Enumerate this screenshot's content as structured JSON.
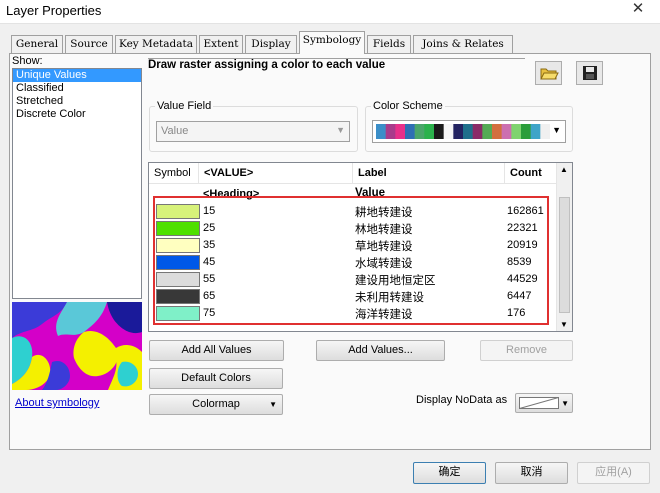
{
  "window": {
    "title": "Layer Properties",
    "close_glyph": "✕"
  },
  "tabs": [
    {
      "label": "General"
    },
    {
      "label": "Source"
    },
    {
      "label": "Key Metadata"
    },
    {
      "label": "Extent"
    },
    {
      "label": "Display"
    },
    {
      "label": "Symbology"
    },
    {
      "label": "Fields"
    },
    {
      "label": "Joins & Relates"
    }
  ],
  "show": {
    "label": "Show:",
    "items": [
      {
        "label": "Unique Values"
      },
      {
        "label": "Classified"
      },
      {
        "label": "Stretched"
      },
      {
        "label": "Discrete Color"
      }
    ],
    "selected": "Unique Values",
    "about_link": "About symbology"
  },
  "description": "Draw raster assigning a color to each value",
  "value_field": {
    "label": "Value Field",
    "value": "Value"
  },
  "color_scheme": {
    "label": "Color Scheme",
    "colors": [
      "#3b8ec8",
      "#a93b8b",
      "#e8308a",
      "#2f6fb4",
      "#4aa66a",
      "#2bb24c",
      "#1a1a1a",
      "#f5f5f5",
      "#232361",
      "#1f6f8b",
      "#8a2b68",
      "#55aa55",
      "#d36f3f",
      "#cc6fb0",
      "#7fd36f",
      "#2a9d3a",
      "#3ea4c8",
      "#f0f0f0"
    ]
  },
  "table": {
    "headers": {
      "symbol": "Symbol",
      "value": "<VALUE>",
      "label": "Label",
      "count": "Count"
    },
    "heading_row": {
      "value": "<Heading>",
      "label": "Value"
    },
    "rows": [
      {
        "value": "15",
        "label": "耕地转建设",
        "count": "162861",
        "color": "#d7f27a"
      },
      {
        "value": "25",
        "label": "林地转建设",
        "count": "22321",
        "color": "#4fe000"
      },
      {
        "value": "35",
        "label": "草地转建设",
        "count": "20919",
        "color": "#ffffc0"
      },
      {
        "value": "45",
        "label": "水域转建设",
        "count": "8539",
        "color": "#0058e8"
      },
      {
        "value": "55",
        "label": "建设用地恒定区",
        "count": "44529",
        "color": "#dcdcdc"
      },
      {
        "value": "65",
        "label": "未利用转建设",
        "count": "6447",
        "color": "#383838"
      },
      {
        "value": "75",
        "label": "海洋转建设",
        "count": "176",
        "color": "#7ff0c8"
      }
    ]
  },
  "buttons": {
    "add_all": "Add All Values",
    "add_values": "Add Values...",
    "remove": "Remove",
    "default_colors": "Default Colors",
    "colormap": "Colormap",
    "ok": "确定",
    "cancel": "取消",
    "apply": "应用(A)"
  },
  "nodata": {
    "label": "Display NoData as"
  }
}
